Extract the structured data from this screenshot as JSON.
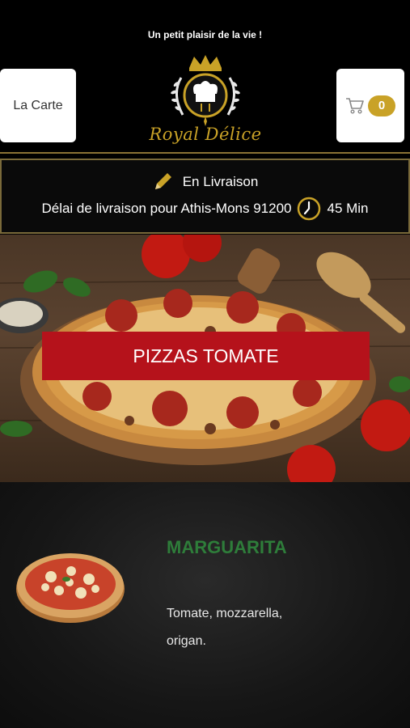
{
  "header": {
    "tagline": "Un petit plaisir de la vie !",
    "menu_button_label": "La Carte",
    "cart_count": "0",
    "logo_text": "Royal Délice"
  },
  "delivery": {
    "mode": "En Livraison",
    "delay_text": "Délai de livraison pour Athis-Mons 91200",
    "delay_time": "45 Min"
  },
  "category": {
    "title": "PIZZAS TOMATE"
  },
  "items": [
    {
      "name": "MARGUARITA",
      "description": "Tomate, mozzarella, origan."
    }
  ],
  "colors": {
    "gold": "#c9a227",
    "category_red": "#b5121b",
    "item_name_green": "#2e7d3a"
  }
}
